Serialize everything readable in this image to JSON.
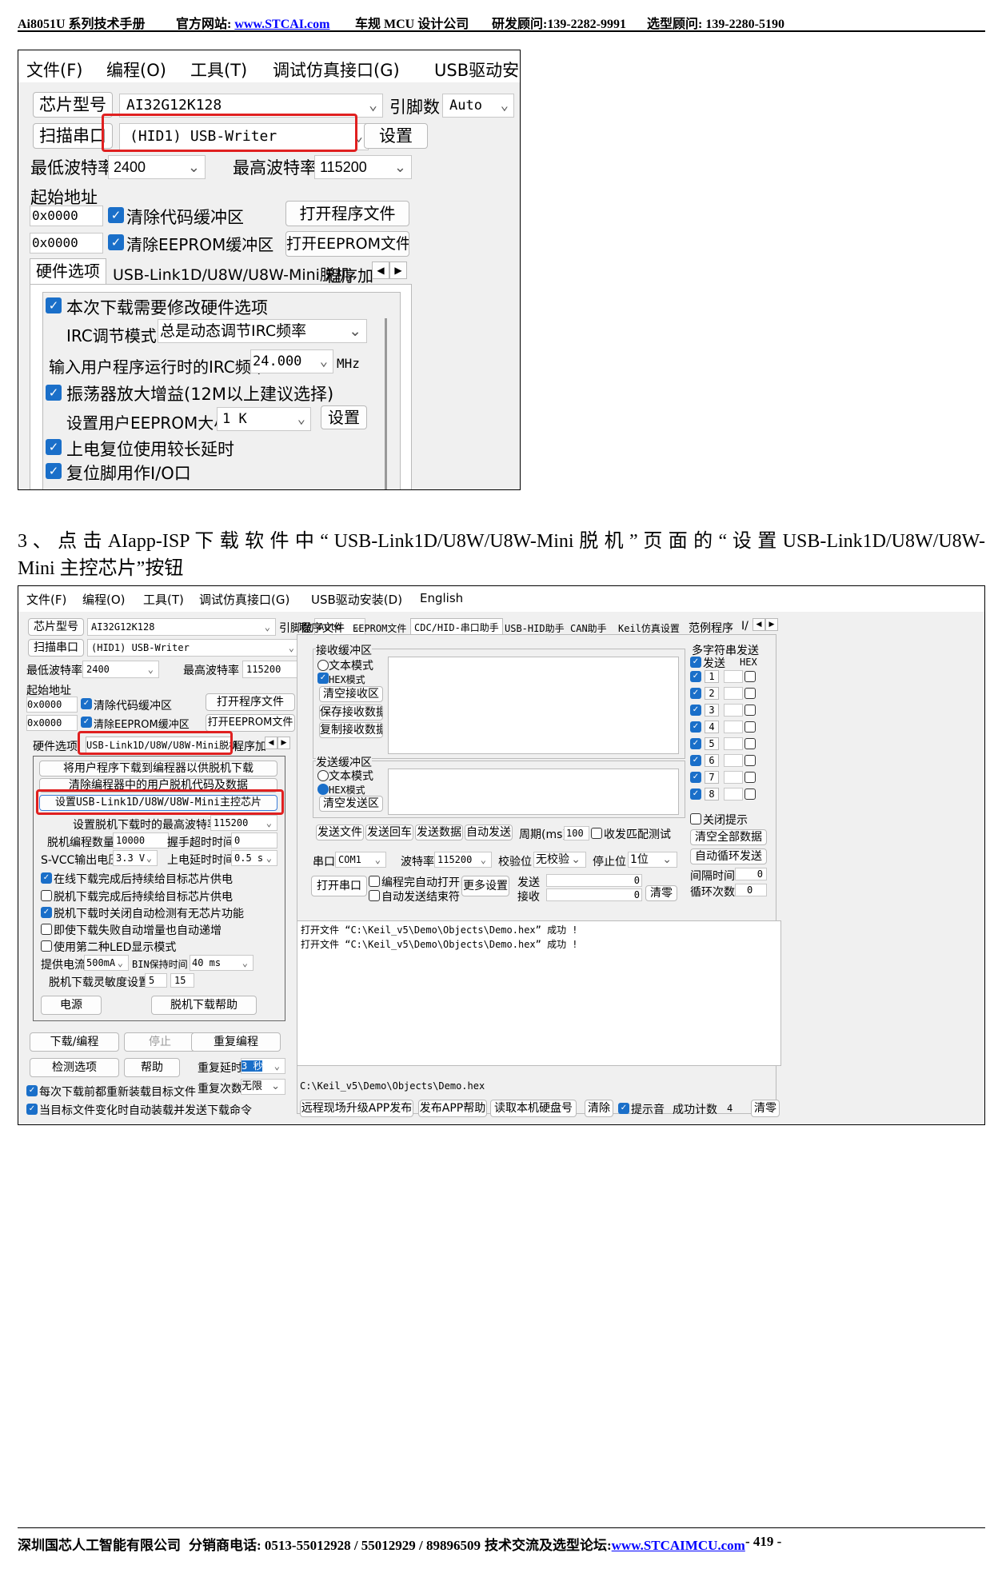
{
  "header": {
    "doc": "Ai8051U 系列技术手册",
    "site_label": "官方网站:",
    "site_url": "www.STCAI.com",
    "company": "车规 MCU 设计公司",
    "rd": "研发顾问:139-2282-9991",
    "sel": "选型顾问: 139-2280-5190"
  },
  "footer": {
    "company": "深圳国芯人工智能有限公司",
    "phone": "分销商电话: 0513-55012928 / 55012929 / 89896509",
    "forum_label": "技术交流及选型论坛:",
    "forum_url": "www.STCAIMCU.com",
    "page": "- 419 -"
  },
  "paragraph": "3 、 点 击 AIapp-ISP 下 载 软 件 中 “ USB-Link1D/U8W/U8W-Mini 脱 机 ” 页 面 的 “ 设 置 USB-Link1D/U8W/U8W-Mini 主控芯片”按钮",
  "s1": {
    "menu": [
      "文件(F)",
      "编程(O)",
      "工具(T)",
      "调试仿真接口(G)",
      "USB驱动安"
    ],
    "chip_label": "芯片型号",
    "chip": "AI32G12K128",
    "pins_label": "引脚数",
    "pins": "Auto",
    "scan_label": "扫描串口",
    "port": "(HID1) USB-Writer",
    "set": "设置",
    "min_baud_label": "最低波特率",
    "min_baud": "2400",
    "max_baud_label": "最高波特率",
    "max_baud": "115200",
    "start_addr": "起始地址",
    "addr1": "0x0000",
    "clear_code": "清除代码缓冲区",
    "open_prog": "打开程序文件",
    "addr2": "0x0000",
    "clear_eep": "清除EEPROM缓冲区",
    "open_eep": "打开EEPROM文件",
    "tabs": [
      "硬件选项",
      "USB-Link1D/U8W/U8W-Mini脱机",
      "程序加"
    ],
    "opt1": "本次下载需要修改硬件选项",
    "irc_label": "IRC调节模式",
    "irc": "总是动态调节IRC频率",
    "freq_label": "输入用户程序运行时的IRC频率",
    "freq": "24.000",
    "mhz": "MHz",
    "osc": "振荡器放大增益(12M以上建议选择)",
    "eep_label": "设置用户EEPROM大小",
    "eep": "1  K",
    "eep_set": "设置",
    "por": "上电复位使用较长延时",
    "rst": "复位脚用作I/O口"
  },
  "s2": {
    "menu": [
      "文件(F)",
      "编程(O)",
      "工具(T)",
      "调试仿真接口(G)",
      "USB驱动安装(D)",
      "English"
    ],
    "chip_label": "芯片型号",
    "chip": "AI32G12K128",
    "pins_label": "引脚数",
    "pins": "Auto",
    "scan_label": "扫描串口",
    "port": "(HID1) USB-Writer",
    "set": "设置",
    "min_baud_label": "最低波特率",
    "min_baud": "2400",
    "max_baud_label": "最高波特率",
    "max_baud": "115200",
    "start_addr": "起始地址",
    "addr1": "0x0000",
    "clear_code": "清除代码缓冲区",
    "open_prog": "打开程序文件",
    "addr2": "0x0000",
    "clear_eep": "清除EEPROM缓冲区",
    "open_eep": "打开EEPROM文件",
    "tabs": [
      "硬件选项",
      "USB-Link1D/U8W/U8W-Mini脱机",
      "程序加"
    ],
    "off_btn1": "将用户程序下载到编程器以供脱机下载",
    "off_btn2": "清除编程器中的用户脱机代码及数据",
    "off_btn3": "设置USB-Link1D/U8W/U8W-Mini主控芯片",
    "max_baud_off_label": "设置脱机下载时的最高波特率",
    "max_baud_off": "115200",
    "cnt_label": "脱机编程数量",
    "cnt": "10000",
    "hs_label": "握手超时时间",
    "hs": "0",
    "svcc_label": "S-VCC输出电压",
    "svcc": "3.3 V",
    "pwr_delay_label": "上电延时时间",
    "pwr_delay": "0.5 s",
    "c1": "在线下载完成后持续给目标芯片供电",
    "c2": "脱机下载完成后持续给目标芯片供电",
    "c3": "脱机下载时关闭自动检测有无芯片功能",
    "c4": "即使下载失败自动增量也自动递增",
    "c5": "使用第二种LED显示模式",
    "cur_label": "提供电流",
    "cur": "500mA",
    "bin_label": "BIN保持时间",
    "bin": "40 ms",
    "sens_label": "脱机下载灵敏度设置",
    "sens1": "5",
    "sens2": "15",
    "power": "电源",
    "help_off": "脱机下载帮助",
    "download": "下载/编程",
    "stop": "停止",
    "reprog": "重复编程",
    "check": "检测选项",
    "help": "帮助",
    "delay_label": "重复延时",
    "delay": "3 秒",
    "times_label": "重复次数",
    "times": "无限",
    "reload1": "每次下载前都重新装载目标文件",
    "reload2": "当目标文件变化时自动装载并发送下载命令",
    "rtabs": [
      "程序文件",
      "EEPROM文件",
      "CDC/HID-串口助手",
      "USB-HID助手",
      "CAN助手",
      "Keil仿真设置",
      "范例程序",
      "I/"
    ],
    "rx_title": "接收缓冲区",
    "text_mode": "文本模式",
    "hex_mode": "HEX模式",
    "clear_rx": "清空接收区",
    "save_rx": "保存接收数据",
    "copy_rx": "复制接收数据",
    "tx_title": "发送缓冲区",
    "clear_tx": "清空发送区",
    "send_file": "发送文件",
    "send_cr": "发送回车",
    "send_data": "发送数据",
    "auto_send": "自动发送",
    "period_label": "周期(ms)",
    "period": "100",
    "match": "收发匹配测试",
    "com_label": "串口",
    "com": "COM1",
    "baud_label": "波特率",
    "baud": "115200",
    "parity_label": "校验位",
    "parity": "无校验",
    "stop_label": "停止位",
    "stopbits": "1位",
    "open_port": "打开串口",
    "auto_open": "编程完自动打开",
    "auto_close": "自动发送结束符",
    "more": "更多设置",
    "send_l": "发送",
    "recv_l": "接收",
    "sent": "0",
    "recv": "0",
    "zero": "清零",
    "multi_title": "多字符串发送",
    "send_col": "发送",
    "hex_col": "HEX",
    "items": [
      "1",
      "2",
      "3",
      "4",
      "5",
      "6",
      "7",
      "8"
    ],
    "close_tip": "关闭提示",
    "clear_all": "清空全部数据",
    "auto_loop": "自动循环发送",
    "interval_label": "间隔时间",
    "interval": "0",
    "loop_label": "循环次数",
    "loop": "0",
    "log": [
      "打开文件 “C:\\Keil_v5\\Demo\\Objects\\Demo.hex” 成功 !",
      "打开文件 “C:\\Keil_v5\\Demo\\Objects\\Demo.hex” 成功 !"
    ],
    "path": "C:\\Keil_v5\\Demo\\Objects\\Demo.hex",
    "remote": "远程现场升级APP发布",
    "publish": "发布APP帮助",
    "read_hd": "读取本机硬盘号",
    "clear": "清除",
    "beep": "提示音",
    "succ_label": "成功计数",
    "succ": "4",
    "zero2": "清零"
  }
}
